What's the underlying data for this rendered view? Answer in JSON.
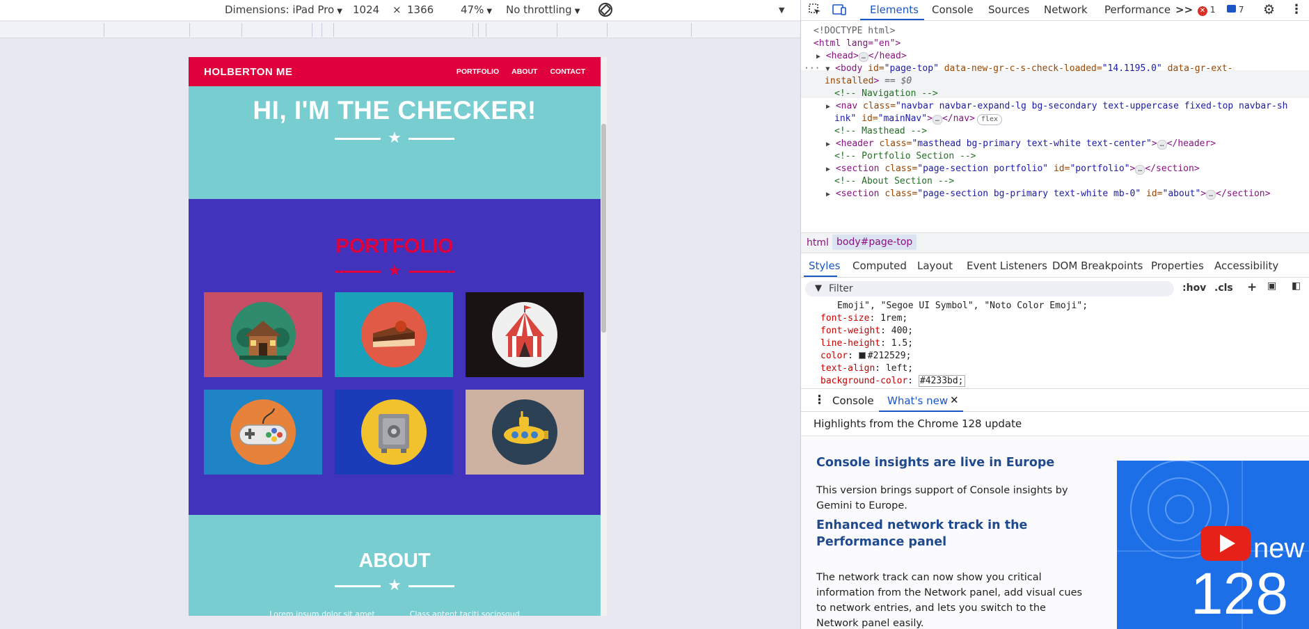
{
  "device_toolbar": {
    "dimensions_label": "Dimensions: iPad Pro",
    "width": "1024",
    "times": "×",
    "height": "1366",
    "zoom": "47%",
    "throttling": "No throttling"
  },
  "site": {
    "brand": "HOLBERTON ME",
    "nav_links": [
      "PORTFOLIO",
      "ABOUT",
      "CONTACT"
    ],
    "masthead_title": "HI, I'M THE CHECKER!",
    "portfolio_title": "PORTFOLIO",
    "about_title": "ABOUT",
    "about_text_left": "Lorem ipsum dolor sit amet",
    "about_text_right": "Class aptent taciti sociosqud",
    "colors": {
      "nav": "#e0003b",
      "masthead": "#78cdd1",
      "portfolio_bg": "#4233bd"
    },
    "tiles": [
      {
        "name": "cabin",
        "bg": "#c64e65",
        "circle": "#2f8b6c"
      },
      {
        "name": "cake",
        "bg": "#1aa0b8",
        "circle": "#e05a45"
      },
      {
        "name": "circus",
        "bg": "#1a1314",
        "circle": "#f0f0f0"
      },
      {
        "name": "game-controller",
        "bg": "#1e84c6",
        "circle": "#e7823a"
      },
      {
        "name": "safe",
        "bg": "#1b3cb8",
        "circle": "#f2c22e"
      },
      {
        "name": "submarine",
        "bg": "#cdb1a1",
        "circle": "#2c4154"
      }
    ]
  },
  "devtools": {
    "tabs": [
      "Elements",
      "Console",
      "Sources",
      "Network",
      "Performance"
    ],
    "more": ">>",
    "error_count": "1",
    "message_count": "7",
    "elements_lines": {
      "doctype": "<!DOCTYPE html>",
      "html_open": "<html lang=\"en\">",
      "head": "<head>",
      "head_close": "</head>",
      "body_tag": "<body",
      "body_id_attr": "id=",
      "body_id_val": "\"page-top\"",
      "body_check_attr": "data-new-gr-c-s-check-loaded=",
      "body_check_val": "\"14.1195.0\"",
      "body_ext_attr": "data-gr-ext-",
      "body_ext_attr2": "installed",
      "body_gt": ">",
      "eq0": "== $0",
      "cmt_nav": "<!-- Navigation -->",
      "nav_tag": "<nav",
      "nav_class_attr": "class=",
      "nav_class_val": "\"navbar navbar-expand-lg bg-secondary text-uppercase fixed-top navbar-sh",
      "nav_class_val2": "ink\"",
      "nav_id_attr": "id=",
      "nav_id_val": "\"mainNav\"",
      "nav_close": "</nav>",
      "flex_badge": "flex",
      "cmt_masthead": "<!-- Masthead -->",
      "header_tag": "<header",
      "header_class_attr": "class=",
      "header_class_val": "\"masthead bg-primary text-white text-center\"",
      "header_close": "</header>",
      "cmt_portfolio": "<!-- Portfolio Section -->",
      "section_tag": "<section",
      "sec1_class_attr": "class=",
      "sec1_class_val": "\"page-section portfolio\"",
      "sec1_id_attr": "id=",
      "sec1_id_val": "\"portfolio\"",
      "section_close": "</section>",
      "cmt_about": "<!-- About Section -->",
      "sec2_class_val": "\"page-section bg-primary text-white mb-0\"",
      "sec2_id_val": "\"about\""
    },
    "breadcrumb": [
      "html",
      "body#page-top"
    ],
    "subtabs": [
      "Styles",
      "Computed",
      "Layout",
      "Event Listeners",
      "DOM Breakpoints",
      "Properties",
      "Accessibility"
    ],
    "filter_placeholder": "Filter",
    "hov": ":hov",
    "cls": ".cls",
    "styles": {
      "font_family_tail": "Emoji\", \"Segoe UI Symbol\", \"Noto Color Emoji\";",
      "font_size_prop": "font-size",
      "font_size_val": "1rem;",
      "font_weight_prop": "font-weight",
      "font_weight_val": "400;",
      "line_height_prop": "line-height",
      "line_height_val": "1.5;",
      "color_prop": "color",
      "color_val": "#212529;",
      "text_align_prop": "text-align",
      "text_align_val": "left;",
      "bg_color_prop": "background-color",
      "bg_color_val": "#4233bd;"
    },
    "drawer_tabs": [
      "Console",
      "What's new"
    ],
    "whats_new": {
      "highlights": "Highlights from the Chrome 128 update",
      "h1": "Console insights are live in Europe",
      "p1": "This version brings support of Console insights by Gemini to Europe.",
      "h2": "Enhanced network track in the Performance panel",
      "p2": "The network track can now show you critical information from the Network panel, add visual cues to network entries, and lets you switch to the Network panel easily.",
      "image_text": "new 128"
    }
  }
}
